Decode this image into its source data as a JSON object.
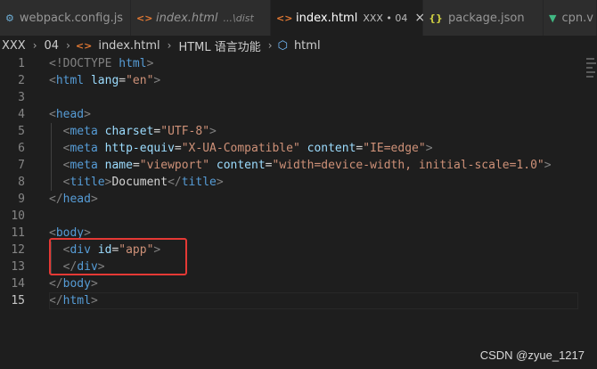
{
  "tabs": [
    {
      "label": "webpack.config.js",
      "description": "",
      "icon": "gear-icon",
      "icon_glyph": "⚙",
      "italic": false,
      "active": false
    },
    {
      "label": "index.html",
      "description": "...\\dist",
      "icon": "html-icon",
      "icon_glyph": "<>",
      "italic": true,
      "active": false
    },
    {
      "label": "index.html",
      "description": "XXX • 04",
      "icon": "html-icon",
      "icon_glyph": "<>",
      "italic": false,
      "active": true,
      "close": "×"
    },
    {
      "label": "package.json",
      "description": "",
      "icon": "json-icon",
      "icon_glyph": "{}",
      "italic": false,
      "active": false
    },
    {
      "label": "cpn.v",
      "description": "",
      "icon": "vue-icon",
      "icon_glyph": "▼",
      "italic": false,
      "active": false
    }
  ],
  "breadcrumb": {
    "items": [
      "XXX",
      "04",
      "index.html",
      "HTML 语言功能",
      "html"
    ],
    "separator": "›",
    "file_icon": "<>",
    "element_icon": "⬡"
  },
  "editor": {
    "line_numbers": [
      "1",
      "2",
      "3",
      "4",
      "5",
      "6",
      "7",
      "8",
      "9",
      "10",
      "11",
      "12",
      "13",
      "14",
      "15"
    ],
    "current_line": 15,
    "lines": [
      [
        {
          "t": "<!DOCTYPE ",
          "c": "punc"
        },
        {
          "t": "html",
          "c": "kw"
        },
        {
          "t": ">",
          "c": "punc"
        }
      ],
      [
        {
          "t": "<",
          "c": "punc"
        },
        {
          "t": "html",
          "c": "tag"
        },
        {
          "t": " ",
          "c": "text"
        },
        {
          "t": "lang",
          "c": "attr"
        },
        {
          "t": "=",
          "c": "text"
        },
        {
          "t": "\"en\"",
          "c": "str"
        },
        {
          "t": ">",
          "c": "punc"
        }
      ],
      [],
      [
        {
          "t": "<",
          "c": "punc"
        },
        {
          "t": "head",
          "c": "tag"
        },
        {
          "t": ">",
          "c": "punc"
        }
      ],
      [
        {
          "t": "  ",
          "c": "text"
        },
        {
          "t": "<",
          "c": "punc"
        },
        {
          "t": "meta",
          "c": "tag"
        },
        {
          "t": " ",
          "c": "text"
        },
        {
          "t": "charset",
          "c": "attr"
        },
        {
          "t": "=",
          "c": "text"
        },
        {
          "t": "\"UTF-8\"",
          "c": "str"
        },
        {
          "t": ">",
          "c": "punc"
        }
      ],
      [
        {
          "t": "  ",
          "c": "text"
        },
        {
          "t": "<",
          "c": "punc"
        },
        {
          "t": "meta",
          "c": "tag"
        },
        {
          "t": " ",
          "c": "text"
        },
        {
          "t": "http-equiv",
          "c": "attr"
        },
        {
          "t": "=",
          "c": "text"
        },
        {
          "t": "\"X-UA-Compatible\"",
          "c": "str"
        },
        {
          "t": " ",
          "c": "text"
        },
        {
          "t": "content",
          "c": "attr"
        },
        {
          "t": "=",
          "c": "text"
        },
        {
          "t": "\"IE=edge\"",
          "c": "str"
        },
        {
          "t": ">",
          "c": "punc"
        }
      ],
      [
        {
          "t": "  ",
          "c": "text"
        },
        {
          "t": "<",
          "c": "punc"
        },
        {
          "t": "meta",
          "c": "tag"
        },
        {
          "t": " ",
          "c": "text"
        },
        {
          "t": "name",
          "c": "attr"
        },
        {
          "t": "=",
          "c": "text"
        },
        {
          "t": "\"viewport\"",
          "c": "str"
        },
        {
          "t": " ",
          "c": "text"
        },
        {
          "t": "content",
          "c": "attr"
        },
        {
          "t": "=",
          "c": "text"
        },
        {
          "t": "\"width=device-width, initial-scale=1.0\"",
          "c": "str"
        },
        {
          "t": ">",
          "c": "punc"
        }
      ],
      [
        {
          "t": "  ",
          "c": "text"
        },
        {
          "t": "<",
          "c": "punc"
        },
        {
          "t": "title",
          "c": "tag"
        },
        {
          "t": ">",
          "c": "punc"
        },
        {
          "t": "Document",
          "c": "text"
        },
        {
          "t": "</",
          "c": "punc"
        },
        {
          "t": "title",
          "c": "tag"
        },
        {
          "t": ">",
          "c": "punc"
        }
      ],
      [
        {
          "t": "</",
          "c": "punc"
        },
        {
          "t": "head",
          "c": "tag"
        },
        {
          "t": ">",
          "c": "punc"
        }
      ],
      [],
      [
        {
          "t": "<",
          "c": "punc"
        },
        {
          "t": "body",
          "c": "tag"
        },
        {
          "t": ">",
          "c": "punc"
        }
      ],
      [
        {
          "t": "  ",
          "c": "text"
        },
        {
          "t": "<",
          "c": "punc"
        },
        {
          "t": "div",
          "c": "tag"
        },
        {
          "t": " ",
          "c": "text"
        },
        {
          "t": "id",
          "c": "attr"
        },
        {
          "t": "=",
          "c": "text"
        },
        {
          "t": "\"app\"",
          "c": "str"
        },
        {
          "t": ">",
          "c": "punc"
        }
      ],
      [
        {
          "t": "  ",
          "c": "text"
        },
        {
          "t": "</",
          "c": "punc"
        },
        {
          "t": "div",
          "c": "tag"
        },
        {
          "t": ">",
          "c": "punc"
        }
      ],
      [
        {
          "t": "</",
          "c": "punc"
        },
        {
          "t": "body",
          "c": "tag"
        },
        {
          "t": ">",
          "c": "punc"
        }
      ],
      [
        {
          "t": "</",
          "c": "punc"
        },
        {
          "t": "html",
          "c": "tag"
        },
        {
          "t": ">",
          "c": "punc"
        }
      ]
    ]
  },
  "colors": {
    "highlight_box": "#e53935",
    "editor_bg": "#1e1e1e",
    "tag": "#569cd6",
    "attribute": "#9cdcfe",
    "string": "#ce9178"
  },
  "watermark": "CSDN @zyue_1217"
}
